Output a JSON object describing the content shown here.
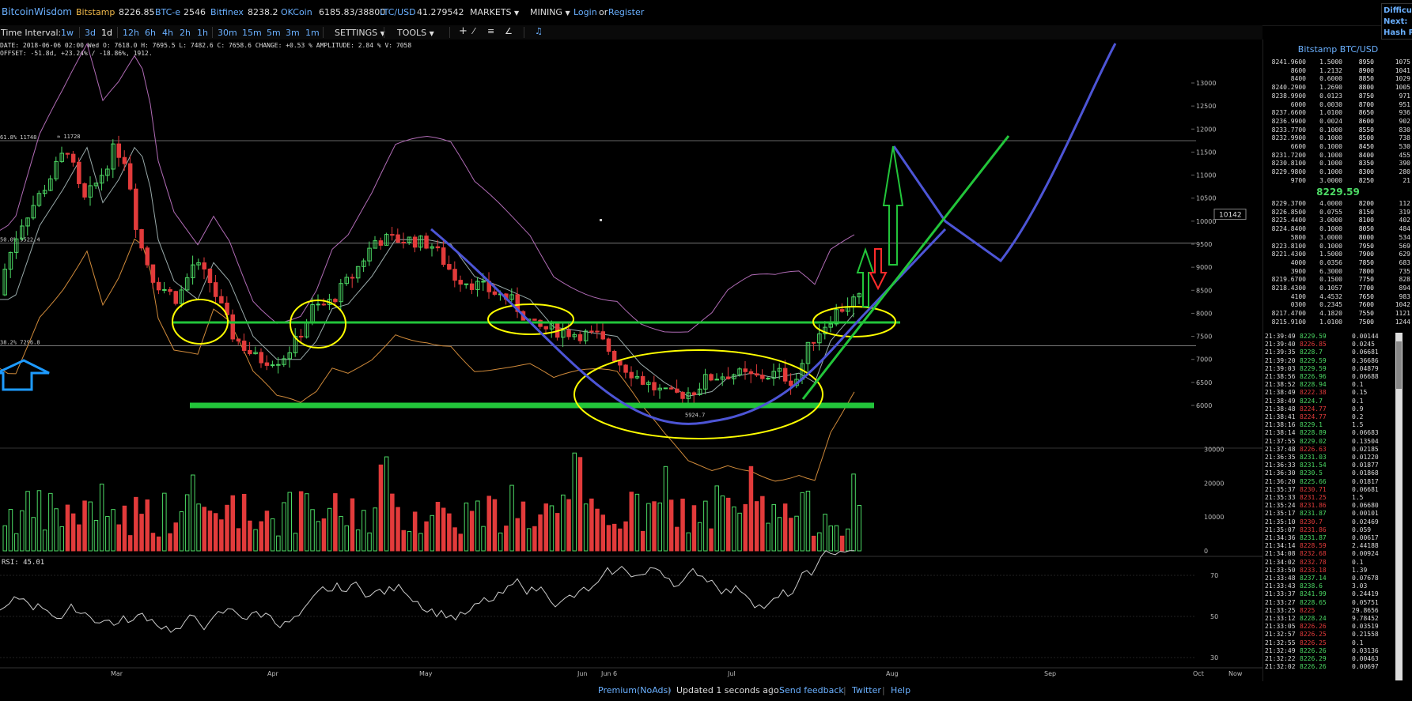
{
  "topbar": {
    "brand": "BitcoinWisdom",
    "tickers": [
      {
        "exchange": "Bitstamp",
        "price": "8226.85"
      },
      {
        "exchange": "BTC-e",
        "price": "2546"
      },
      {
        "exchange": "Bitfinex",
        "price": "8238.2"
      },
      {
        "exchange": "OKCoin",
        "price": "6185.83/38800"
      },
      {
        "exchange": "LTC/USD",
        "price": "41.279542"
      }
    ],
    "markets": "MARKETS",
    "mining": "MINING",
    "login": "Login",
    "or": "or",
    "register": "Register"
  },
  "corner": {
    "line1": "Difficu",
    "line2": "Next:",
    "line3": "Hash R"
  },
  "toolbar": {
    "label": "Time Interval:",
    "intervals": [
      "1w",
      "3d",
      "1d",
      "12h",
      "6h",
      "4h",
      "2h",
      "1h",
      "30m",
      "15m",
      "5m",
      "3m",
      "1m"
    ],
    "active_interval": "1d",
    "settings": "SETTINGS",
    "tools": "TOOLS",
    "tool_icons": [
      "crosshair-icon",
      "line-icon",
      "hlines-icon",
      "fib-icon",
      "alert-bell-icon"
    ]
  },
  "info": {
    "line1": "DATE: 2018-06-06 02:00 Wed    O: 7618.0    H: 7695.5    L: 7482.6    C: 7658.6    CHANGE: +0.53 %    AMPLITUDE: 2.84 %    V: 7058",
    "line2": "OFFSET: -51.8d, +23.24% / -18.86%, 1912."
  },
  "chart_data": [
    {
      "type": "candlestick",
      "title": "",
      "yticks": [
        6000,
        6500,
        7000,
        7500,
        8000,
        8500,
        9000,
        9500,
        10000,
        10500,
        11000,
        11500,
        12000,
        12500,
        13000
      ],
      "ylim": [
        5700,
        13300
      ],
      "xticks": [
        "Mar",
        "Apr",
        "May",
        "Jun",
        "Jun 6",
        "Jul",
        "Aug",
        "Sep",
        "Oct",
        "Now"
      ],
      "levels": [
        {
          "label": "61.8% 11748",
          "value": 11748
        },
        {
          "label": "50.0% 9522.4",
          "value": 9522.4
        },
        {
          "label": "38.2% 7296.8",
          "value": 7296.8
        }
      ],
      "annotations": [
        "≈ 11728",
        "5924.7"
      ],
      "price_marker": "10142"
    },
    {
      "type": "bar",
      "title": "",
      "yticks": [
        0,
        10000,
        20000,
        30000
      ],
      "ylim": [
        0,
        32000
      ]
    },
    {
      "type": "line",
      "title": "RSI: 45.01",
      "yticks": [
        30,
        50,
        70
      ],
      "ylim": [
        25,
        85
      ]
    }
  ],
  "colors": {
    "up": "#4cd964",
    "down": "#e23b3b",
    "link": "#6ab0ff",
    "exchange": "#f0b94a",
    "drawing_green": "#22c53a",
    "drawing_yellow": "#ffff00",
    "drawing_blue": "#4d55d6",
    "arrow_red": "#ff2b2b",
    "arrow_cyan": "#1e9bff"
  },
  "orderbook": {
    "title": "Bitstamp BTC/USD",
    "asks": [
      [
        "8241.9600",
        "1.5000",
        "8950",
        "1075"
      ],
      [
        "8600",
        "1.2132",
        "8900",
        "1041"
      ],
      [
        "8400",
        "0.6000",
        "8850",
        "1029"
      ],
      [
        "8240.2900",
        "1.2690",
        "8800",
        "1005"
      ],
      [
        "8238.9900",
        "0.0123",
        "8750",
        "971"
      ],
      [
        "6000",
        "0.0030",
        "8700",
        "951"
      ],
      [
        "8237.6600",
        "1.0100",
        "8650",
        "936"
      ],
      [
        "8236.9900",
        "0.0024",
        "8600",
        "902"
      ],
      [
        "8233.7700",
        "0.1000",
        "8550",
        "830"
      ],
      [
        "8232.9900",
        "0.1000",
        "8500",
        "738"
      ],
      [
        "6600",
        "0.1000",
        "8450",
        "530"
      ],
      [
        "8231.7200",
        "0.1000",
        "8400",
        "455"
      ],
      [
        "8230.8100",
        "0.1000",
        "8350",
        "390"
      ],
      [
        "8229.9800",
        "0.1000",
        "8300",
        "280"
      ],
      [
        "9700",
        "3.0000",
        "8250",
        "21"
      ]
    ],
    "last_price": "8229.59",
    "bids": [
      [
        "8229.3700",
        "4.0000",
        "8200",
        "112"
      ],
      [
        "8226.8500",
        "0.0755",
        "8150",
        "319"
      ],
      [
        "8225.4400",
        "3.0000",
        "8100",
        "402"
      ],
      [
        "8224.8400",
        "0.1000",
        "8050",
        "484"
      ],
      [
        "5800",
        "3.0000",
        "8000",
        "534"
      ],
      [
        "8223.8100",
        "0.1000",
        "7950",
        "569"
      ],
      [
        "8221.4300",
        "1.5000",
        "7900",
        "629"
      ],
      [
        "4000",
        "0.0356",
        "7850",
        "683"
      ],
      [
        "3900",
        "6.3000",
        "7800",
        "735"
      ],
      [
        "8219.6700",
        "0.1500",
        "7750",
        "828"
      ],
      [
        "8218.4300",
        "0.1057",
        "7700",
        "894"
      ],
      [
        "4100",
        "4.4532",
        "7650",
        "983"
      ],
      [
        "0300",
        "0.2345",
        "7600",
        "1042"
      ],
      [
        "8217.4700",
        "4.1820",
        "7550",
        "1121"
      ],
      [
        "8215.9100",
        "1.0100",
        "7500",
        "1244"
      ]
    ]
  },
  "trades": [
    [
      "21:39:49",
      "8229.59",
      "0.00144",
      "up"
    ],
    [
      "21:39:40",
      "8226.85",
      "0.0245",
      "down"
    ],
    [
      "21:39:35",
      "8228.7",
      "0.06681",
      "up"
    ],
    [
      "21:39:20",
      "8229.59",
      "0.36686",
      "up"
    ],
    [
      "21:39:03",
      "8229.59",
      "0.04879",
      "up"
    ],
    [
      "21:38:56",
      "8226.96",
      "0.06688",
      "up"
    ],
    [
      "21:38:52",
      "8228.94",
      "0.1",
      "up"
    ],
    [
      "21:38:49",
      "8222.38",
      "0.15",
      "down"
    ],
    [
      "21:38:49",
      "8224.7",
      "0.1",
      "up"
    ],
    [
      "21:38:48",
      "8224.77",
      "0.9",
      "down"
    ],
    [
      "21:38:41",
      "8224.77",
      "0.2",
      "down"
    ],
    [
      "21:38:16",
      "8229.1",
      "1.5",
      "up"
    ],
    [
      "21:38:14",
      "8228.89",
      "0.06683",
      "up"
    ],
    [
      "21:37:55",
      "8229.02",
      "0.13504",
      "up"
    ],
    [
      "21:37:48",
      "8226.63",
      "0.02185",
      "down"
    ],
    [
      "21:36:35",
      "8231.03",
      "0.01220",
      "up"
    ],
    [
      "21:36:33",
      "8231.54",
      "0.01877",
      "up"
    ],
    [
      "21:36:30",
      "8230.5",
      "0.01868",
      "up"
    ],
    [
      "21:36:20",
      "8225.66",
      "0.01817",
      "up"
    ],
    [
      "21:35:37",
      "8230.71",
      "0.06681",
      "down"
    ],
    [
      "21:35:33",
      "8231.25",
      "1.5",
      "down"
    ],
    [
      "21:35:24",
      "8231.86",
      "0.06680",
      "down"
    ],
    [
      "21:35:17",
      "8231.87",
      "0.00101",
      "up"
    ],
    [
      "21:35:10",
      "8230.7",
      "0.02469",
      "down"
    ],
    [
      "21:35:07",
      "8231.86",
      "0.059",
      "down"
    ],
    [
      "21:34:36",
      "8231.87",
      "0.00617",
      "up"
    ],
    [
      "21:34:14",
      "8228.59",
      "2.44188",
      "down"
    ],
    [
      "21:34:08",
      "8232.68",
      "0.00924",
      "down"
    ],
    [
      "21:34:02",
      "8232.78",
      "0.1",
      "down"
    ],
    [
      "21:33:50",
      "8233.18",
      "1.39",
      "down"
    ],
    [
      "21:33:48",
      "8237.14",
      "0.07678",
      "up"
    ],
    [
      "21:33:43",
      "8238.6",
      "3.03",
      "up"
    ],
    [
      "21:33:37",
      "8241.99",
      "0.24419",
      "up"
    ],
    [
      "21:33:27",
      "8228.65",
      "0.05751",
      "up"
    ],
    [
      "21:33:25",
      "8225",
      "29.8656",
      "down"
    ],
    [
      "21:33:12",
      "8228.24",
      "9.78452",
      "up"
    ],
    [
      "21:33:05",
      "8226.26",
      "0.03519",
      "down"
    ],
    [
      "21:32:57",
      "8226.25",
      "0.21558",
      "down"
    ],
    [
      "21:32:55",
      "8226.25",
      "0.1",
      "down"
    ],
    [
      "21:32:49",
      "8226.26",
      "0.03136",
      "up"
    ],
    [
      "21:32:22",
      "8226.29",
      "0.00463",
      "up"
    ],
    [
      "21:32:02",
      "8226.26",
      "0.00697",
      "up"
    ]
  ],
  "footer": {
    "premium": "Premium(NoAds)",
    "updated": "Updated 1 seconds ago",
    "feedback": "Send feedback",
    "twitter": "Twitter",
    "help": "Help"
  }
}
